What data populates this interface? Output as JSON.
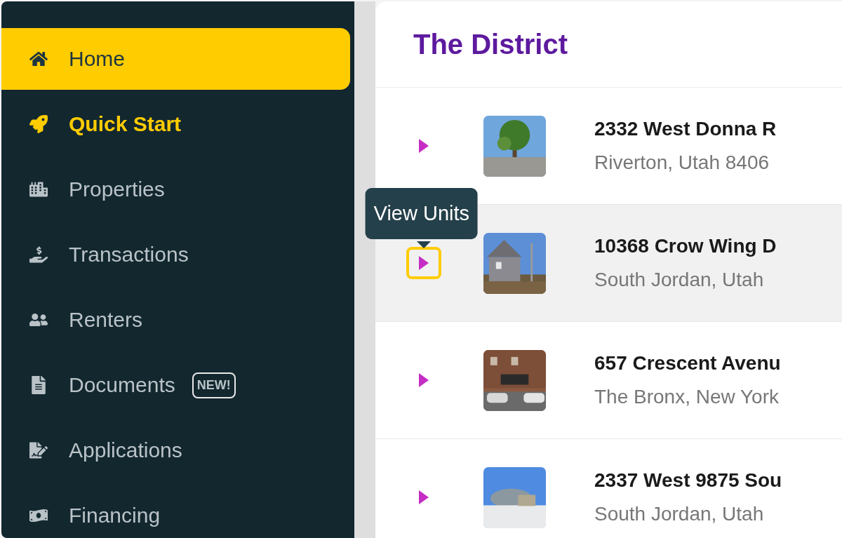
{
  "sidebar": {
    "items": [
      {
        "label": "Home",
        "selected": true,
        "emphasized": false
      },
      {
        "label": "Quick Start",
        "selected": false,
        "emphasized": true
      },
      {
        "label": "Properties",
        "selected": false,
        "emphasized": false
      },
      {
        "label": "Transactions",
        "selected": false,
        "emphasized": false
      },
      {
        "label": "Renters",
        "selected": false,
        "emphasized": false
      },
      {
        "label": "Documents",
        "selected": false,
        "emphasized": false,
        "badge": "NEW!"
      },
      {
        "label": "Applications",
        "selected": false,
        "emphasized": false
      },
      {
        "label": "Financing",
        "selected": false,
        "emphasized": false
      }
    ]
  },
  "panel": {
    "title": "The District",
    "rows": [
      {
        "address": "2332 West Donna R",
        "city": "Riverton, Utah 8406",
        "hovered": false,
        "focused": false
      },
      {
        "address": "10368 Crow Wing D",
        "city": "South Jordan, Utah",
        "hovered": true,
        "focused": true,
        "tooltip": "View Units"
      },
      {
        "address": "657 Crescent Avenu",
        "city": "The Bronx, New York",
        "hovered": false,
        "focused": false
      },
      {
        "address": "2337 West 9875 Sou",
        "city": "South Jordan, Utah",
        "hovered": false,
        "focused": false
      }
    ]
  }
}
